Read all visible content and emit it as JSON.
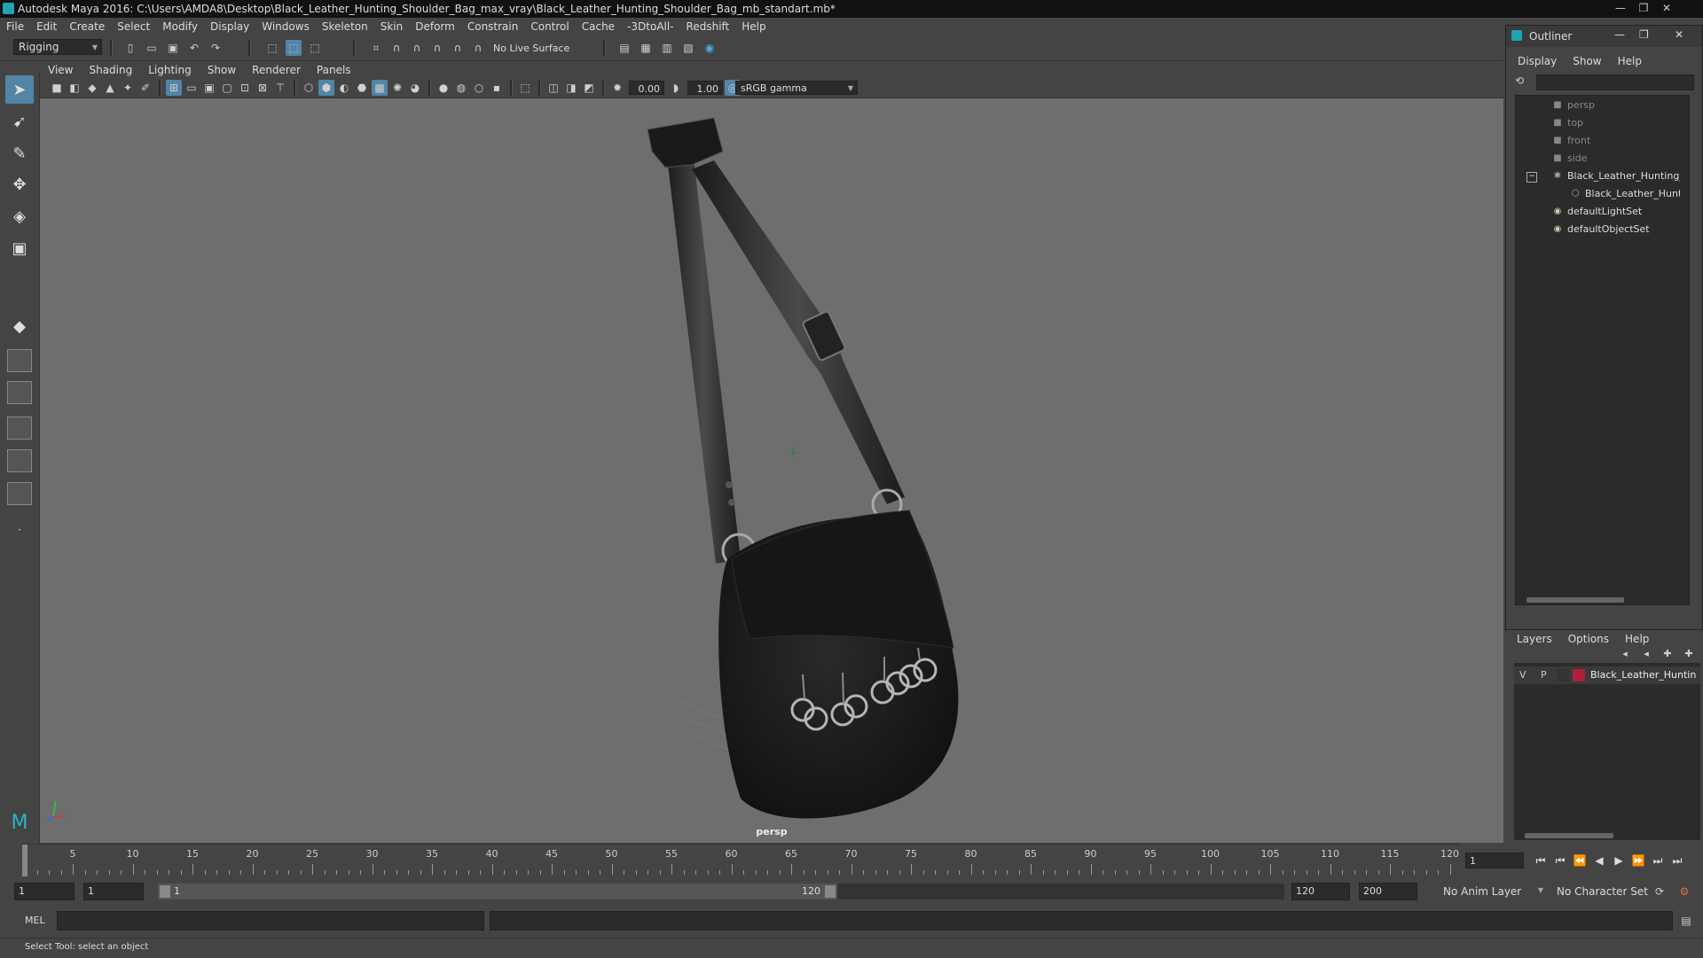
{
  "window": {
    "title": "Autodesk Maya 2016: C:\\Users\\AMDA8\\Desktop\\Black_Leather_Hunting_Shoulder_Bag_max_vray\\Black_Leather_Hunting_Shoulder_Bag_mb_standart.mb*",
    "minimize": "—",
    "restore": "❐",
    "close": "✕"
  },
  "menubar": [
    "File",
    "Edit",
    "Create",
    "Select",
    "Modify",
    "Display",
    "Windows",
    "Skeleton",
    "Skin",
    "Deform",
    "Constrain",
    "Control",
    "Cache",
    "-3DtoAll-",
    "Redshift",
    "Help"
  ],
  "statusline": {
    "menu_set": "Rigging",
    "live_surface": "No Live Surface"
  },
  "panel": {
    "menus": [
      "View",
      "Shading",
      "Lighting",
      "Show",
      "Renderer",
      "Panels"
    ],
    "exposure": "0.00",
    "gamma": "1.00",
    "color_space": "sRGB gamma",
    "camera_label": "persp"
  },
  "outliner": {
    "title": "Outliner",
    "menus": [
      "Display",
      "Show",
      "Help"
    ],
    "items": [
      {
        "label": "persp",
        "icon": "camera-icon",
        "dim": true
      },
      {
        "label": "top",
        "icon": "camera-icon",
        "dim": true
      },
      {
        "label": "front",
        "icon": "camera-icon",
        "dim": true
      },
      {
        "label": "side",
        "icon": "camera-icon",
        "dim": true
      },
      {
        "label": "Black_Leather_Hunting_S",
        "icon": "group-icon",
        "dim": false
      },
      {
        "label": "Black_Leather_Huntin",
        "icon": "mesh-icon",
        "dim": false
      },
      {
        "label": "defaultLightSet",
        "icon": "set-icon",
        "dim": false
      },
      {
        "label": "defaultObjectSet",
        "icon": "set-icon",
        "dim": false
      }
    ]
  },
  "layers": {
    "menus": [
      "Layers",
      "Options",
      "Help"
    ],
    "row": {
      "v": "V",
      "p": "P",
      "name": "Black_Leather_Huntin",
      "color": "#b0203a"
    }
  },
  "timeline": {
    "labels": [
      "1",
      "5",
      "10",
      "15",
      "20",
      "25",
      "30",
      "35",
      "40",
      "45",
      "50",
      "55",
      "60",
      "65",
      "70",
      "75",
      "80",
      "85",
      "90",
      "95",
      "100",
      "105",
      "110",
      "115",
      "120"
    ],
    "current_frame": "1"
  },
  "range": {
    "start": "1",
    "playback_start": "1",
    "slider_start": "1",
    "slider_end": "120",
    "playback_end": "120",
    "end": "200",
    "anim_layer": "No Anim Layer",
    "character_set": "No Character Set"
  },
  "command": {
    "lang": "MEL"
  },
  "help_line": "Select Tool: select an object",
  "colors": {
    "active": "#5285a6",
    "viewport": "#6e6e6e"
  }
}
